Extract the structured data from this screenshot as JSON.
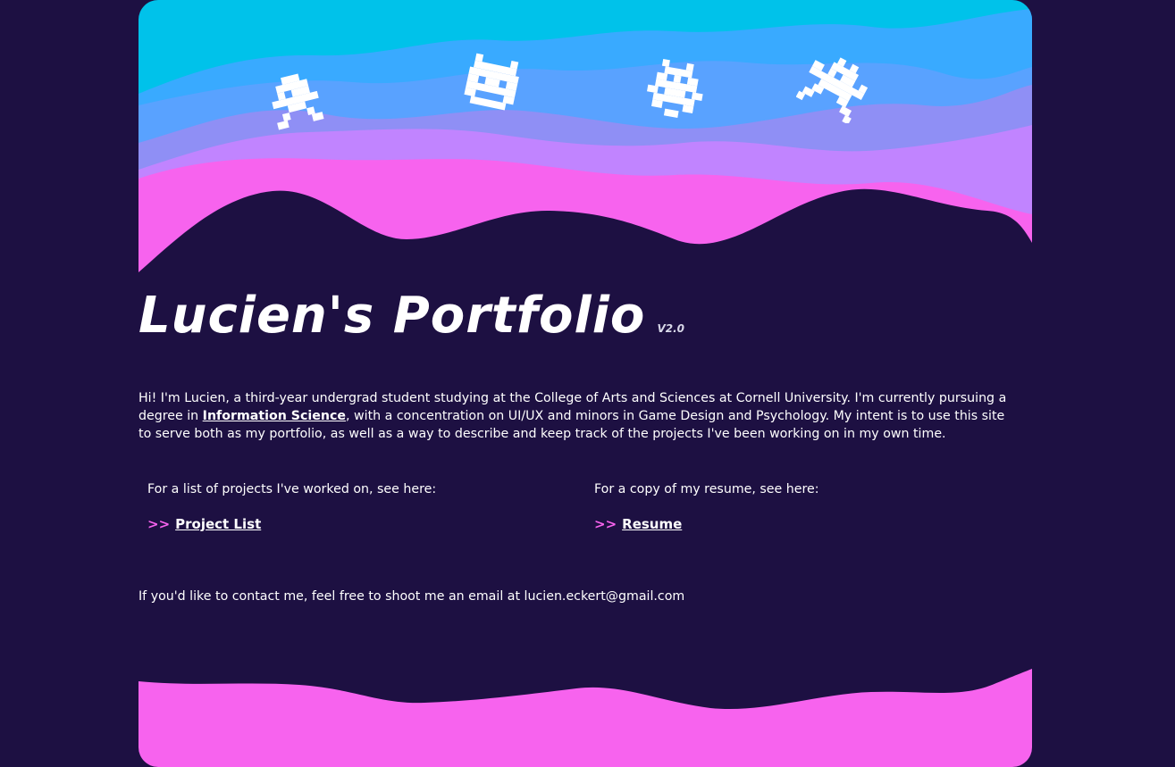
{
  "header": {
    "title": "Lucien's Portfolio",
    "version": "V2.0"
  },
  "intro": {
    "part1": "Hi! I'm Lucien, a third-year undergrad student studying at the College of Arts and Sciences at Cornell University. I'm currently pursuing a degree in ",
    "link_label": "Information Science",
    "part2": ", with a concentration on UI/UX and minors in Game Design and Psychology. My intent is to use this site to serve both as my portfolio, as well as a way to describe and keep track of the projects I've been working on in my own time."
  },
  "projects": {
    "prompt": "For a list of projects I've worked on, see here:",
    "arrows": ">>",
    "link_label": "Project List"
  },
  "resume": {
    "prompt": "For a copy of my resume, see here:",
    "arrows": ">>",
    "link_label": "Resume"
  },
  "contact": {
    "text": "If you'd like to contact me, feel free to shoot me an email at lucien.eckert@gmail.com"
  },
  "colors": {
    "background": "#1d1042",
    "cyan": "#00c2ea",
    "sky": "#39aaff",
    "periwinkle": "#8f8ff5",
    "lavender": "#c184ff",
    "pink": "#f763ee",
    "accent_arrows": "#f763ee"
  },
  "icons": [
    "pixel-alien-icon",
    "pixel-ghost-icon",
    "pixel-bug-icon",
    "pixel-robot-icon"
  ]
}
